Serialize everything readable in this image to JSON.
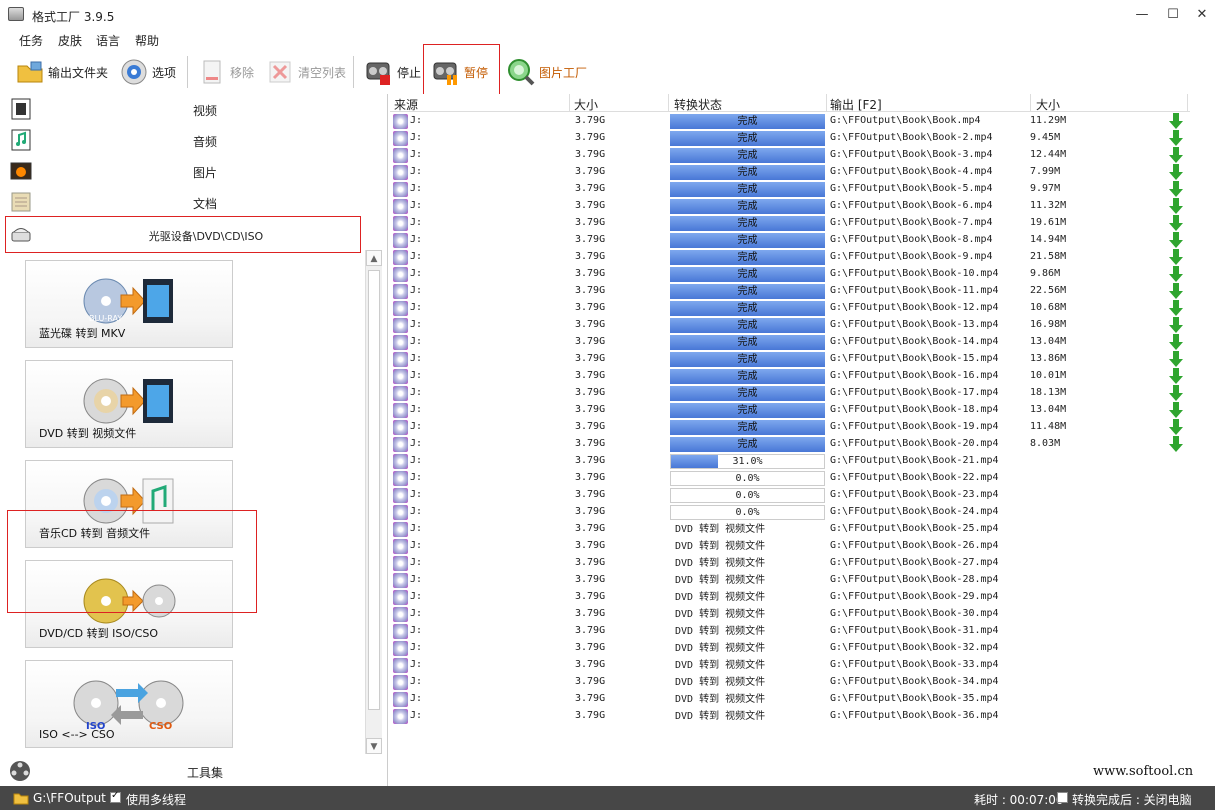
{
  "window": {
    "title": "格式工厂 3.9.5",
    "minimize": "—",
    "maximize": "☐",
    "close": "✕"
  },
  "menu": [
    "任务",
    "皮肤",
    "语言",
    "帮助"
  ],
  "toolbar": {
    "output_folder": "输出文件夹",
    "options": "选项",
    "remove": "移除",
    "clear_list": "清空列表",
    "stop": "停止",
    "pause": "暂停",
    "picture_factory": "图片工厂"
  },
  "categories": [
    "视频",
    "音频",
    "图片",
    "文档",
    "光驱设备\\DVD\\CD\\ISO"
  ],
  "tiles": [
    "蓝光碟 转到 MKV",
    "DVD 转到 视频文件",
    "音乐CD 转到 音频文件",
    "DVD/CD 转到 ISO/CSO",
    "ISO <--> CSO"
  ],
  "tile_badges": {
    "bluray": "BLU-RAY",
    "iso": "ISO",
    "cso": "CSO"
  },
  "tools_label": "工具集",
  "columns": [
    "来源",
    "大小",
    "转换状态",
    "输出 [F2]",
    "大小"
  ],
  "colors": {
    "accent_red": "#dd2222",
    "progress_blue": "#4877d6",
    "arrow_green": "#2fa52f",
    "statusbar": "#474747"
  },
  "rows": [
    {
      "src": "J:",
      "size": "3.79G",
      "status": "完成",
      "type": "done",
      "out": "G:\\FFOutput\\Book\\Book.mp4",
      "osize": "11.29M"
    },
    {
      "src": "J:",
      "size": "3.79G",
      "status": "完成",
      "type": "done",
      "out": "G:\\FFOutput\\Book\\Book-2.mp4",
      "osize": "9.45M"
    },
    {
      "src": "J:",
      "size": "3.79G",
      "status": "完成",
      "type": "done",
      "out": "G:\\FFOutput\\Book\\Book-3.mp4",
      "osize": "12.44M"
    },
    {
      "src": "J:",
      "size": "3.79G",
      "status": "完成",
      "type": "done",
      "out": "G:\\FFOutput\\Book\\Book-4.mp4",
      "osize": "7.99M"
    },
    {
      "src": "J:",
      "size": "3.79G",
      "status": "完成",
      "type": "done",
      "out": "G:\\FFOutput\\Book\\Book-5.mp4",
      "osize": "9.97M"
    },
    {
      "src": "J:",
      "size": "3.79G",
      "status": "完成",
      "type": "done",
      "out": "G:\\FFOutput\\Book\\Book-6.mp4",
      "osize": "11.32M"
    },
    {
      "src": "J:",
      "size": "3.79G",
      "status": "完成",
      "type": "done",
      "out": "G:\\FFOutput\\Book\\Book-7.mp4",
      "osize": "19.61M"
    },
    {
      "src": "J:",
      "size": "3.79G",
      "status": "完成",
      "type": "done",
      "out": "G:\\FFOutput\\Book\\Book-8.mp4",
      "osize": "14.94M"
    },
    {
      "src": "J:",
      "size": "3.79G",
      "status": "完成",
      "type": "done",
      "out": "G:\\FFOutput\\Book\\Book-9.mp4",
      "osize": "21.58M"
    },
    {
      "src": "J:",
      "size": "3.79G",
      "status": "完成",
      "type": "done",
      "out": "G:\\FFOutput\\Book\\Book-10.mp4",
      "osize": "9.86M"
    },
    {
      "src": "J:",
      "size": "3.79G",
      "status": "完成",
      "type": "done",
      "out": "G:\\FFOutput\\Book\\Book-11.mp4",
      "osize": "22.56M"
    },
    {
      "src": "J:",
      "size": "3.79G",
      "status": "完成",
      "type": "done",
      "out": "G:\\FFOutput\\Book\\Book-12.mp4",
      "osize": "10.68M"
    },
    {
      "src": "J:",
      "size": "3.79G",
      "status": "完成",
      "type": "done",
      "out": "G:\\FFOutput\\Book\\Book-13.mp4",
      "osize": "16.98M"
    },
    {
      "src": "J:",
      "size": "3.79G",
      "status": "完成",
      "type": "done",
      "out": "G:\\FFOutput\\Book\\Book-14.mp4",
      "osize": "13.04M"
    },
    {
      "src": "J:",
      "size": "3.79G",
      "status": "完成",
      "type": "done",
      "out": "G:\\FFOutput\\Book\\Book-15.mp4",
      "osize": "13.86M"
    },
    {
      "src": "J:",
      "size": "3.79G",
      "status": "完成",
      "type": "done",
      "out": "G:\\FFOutput\\Book\\Book-16.mp4",
      "osize": "10.01M"
    },
    {
      "src": "J:",
      "size": "3.79G",
      "status": "完成",
      "type": "done",
      "out": "G:\\FFOutput\\Book\\Book-17.mp4",
      "osize": "18.13M"
    },
    {
      "src": "J:",
      "size": "3.79G",
      "status": "完成",
      "type": "done",
      "out": "G:\\FFOutput\\Book\\Book-18.mp4",
      "osize": "13.04M"
    },
    {
      "src": "J:",
      "size": "3.79G",
      "status": "完成",
      "type": "done",
      "out": "G:\\FFOutput\\Book\\Book-19.mp4",
      "osize": "11.48M"
    },
    {
      "src": "J:",
      "size": "3.79G",
      "status": "完成",
      "type": "done",
      "out": "G:\\FFOutput\\Book\\Book-20.mp4",
      "osize": "8.03M"
    },
    {
      "src": "J:",
      "size": "3.79G",
      "status": "31.0%",
      "type": "prog",
      "progress": 0.31,
      "out": "G:\\FFOutput\\Book\\Book-21.mp4",
      "osize": ""
    },
    {
      "src": "J:",
      "size": "3.79G",
      "status": "0.0%",
      "type": "prog",
      "progress": 0,
      "out": "G:\\FFOutput\\Book\\Book-22.mp4",
      "osize": ""
    },
    {
      "src": "J:",
      "size": "3.79G",
      "status": "0.0%",
      "type": "prog",
      "progress": 0,
      "out": "G:\\FFOutput\\Book\\Book-23.mp4",
      "osize": ""
    },
    {
      "src": "J:",
      "size": "3.79G",
      "status": "0.0%",
      "type": "prog",
      "progress": 0,
      "out": "G:\\FFOutput\\Book\\Book-24.mp4",
      "osize": ""
    },
    {
      "src": "J:",
      "size": "3.79G",
      "status": "DVD 转到 视频文件",
      "type": "text",
      "out": "G:\\FFOutput\\Book\\Book-25.mp4",
      "osize": ""
    },
    {
      "src": "J:",
      "size": "3.79G",
      "status": "DVD 转到 视频文件",
      "type": "text",
      "out": "G:\\FFOutput\\Book\\Book-26.mp4",
      "osize": ""
    },
    {
      "src": "J:",
      "size": "3.79G",
      "status": "DVD 转到 视频文件",
      "type": "text",
      "out": "G:\\FFOutput\\Book\\Book-27.mp4",
      "osize": ""
    },
    {
      "src": "J:",
      "size": "3.79G",
      "status": "DVD 转到 视频文件",
      "type": "text",
      "out": "G:\\FFOutput\\Book\\Book-28.mp4",
      "osize": ""
    },
    {
      "src": "J:",
      "size": "3.79G",
      "status": "DVD 转到 视频文件",
      "type": "text",
      "out": "G:\\FFOutput\\Book\\Book-29.mp4",
      "osize": ""
    },
    {
      "src": "J:",
      "size": "3.79G",
      "status": "DVD 转到 视频文件",
      "type": "text",
      "out": "G:\\FFOutput\\Book\\Book-30.mp4",
      "osize": ""
    },
    {
      "src": "J:",
      "size": "3.79G",
      "status": "DVD 转到 视频文件",
      "type": "text",
      "out": "G:\\FFOutput\\Book\\Book-31.mp4",
      "osize": ""
    },
    {
      "src": "J:",
      "size": "3.79G",
      "status": "DVD 转到 视频文件",
      "type": "text",
      "out": "G:\\FFOutput\\Book\\Book-32.mp4",
      "osize": ""
    },
    {
      "src": "J:",
      "size": "3.79G",
      "status": "DVD 转到 视频文件",
      "type": "text",
      "out": "G:\\FFOutput\\Book\\Book-33.mp4",
      "osize": ""
    },
    {
      "src": "J:",
      "size": "3.79G",
      "status": "DVD 转到 视频文件",
      "type": "text",
      "out": "G:\\FFOutput\\Book\\Book-34.mp4",
      "osize": ""
    },
    {
      "src": "J:",
      "size": "3.79G",
      "status": "DVD 转到 视频文件",
      "type": "text",
      "out": "G:\\FFOutput\\Book\\Book-35.mp4",
      "osize": ""
    },
    {
      "src": "J:",
      "size": "3.79G",
      "status": "DVD 转到 视频文件",
      "type": "text",
      "out": "G:\\FFOutput\\Book\\Book-36.mp4",
      "osize": ""
    }
  ],
  "watermark": "www.softool.cn",
  "statusbar": {
    "output_path": "G:\\FFOutput",
    "multithread_label": "使用多线程",
    "elapsed": "耗时 : 00:07:00",
    "after_label": "转换完成后 : 关闭电脑"
  }
}
